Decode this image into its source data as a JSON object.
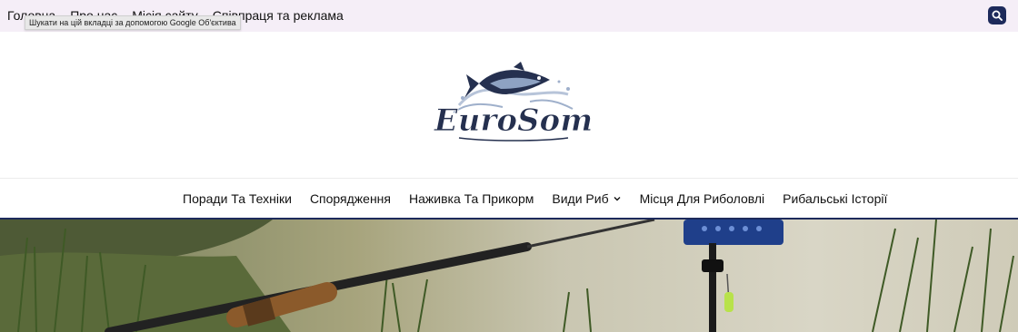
{
  "top_nav": {
    "links": [
      "Головна",
      "Про нас",
      "Місія сайту",
      "Співпраця та реклама"
    ]
  },
  "tooltip": "Шукати на цій вкладці за допомогою Google Об'єктива",
  "search": {
    "icon": "search-icon"
  },
  "logo": {
    "text": "EuroSom"
  },
  "main_nav": {
    "items": [
      {
        "label": "Поради Та Техніки"
      },
      {
        "label": "Спорядження"
      },
      {
        "label": "Наживка Та Прикорм"
      },
      {
        "label": "Види Риб",
        "icon": "chevron-down-icon"
      },
      {
        "label": "Місця Для Риболовлі"
      },
      {
        "label": "Рибальські Історії"
      }
    ]
  },
  "colors": {
    "topbar_bg": "#f5eef7",
    "accent": "#1d2a5b",
    "text": "#111111"
  }
}
